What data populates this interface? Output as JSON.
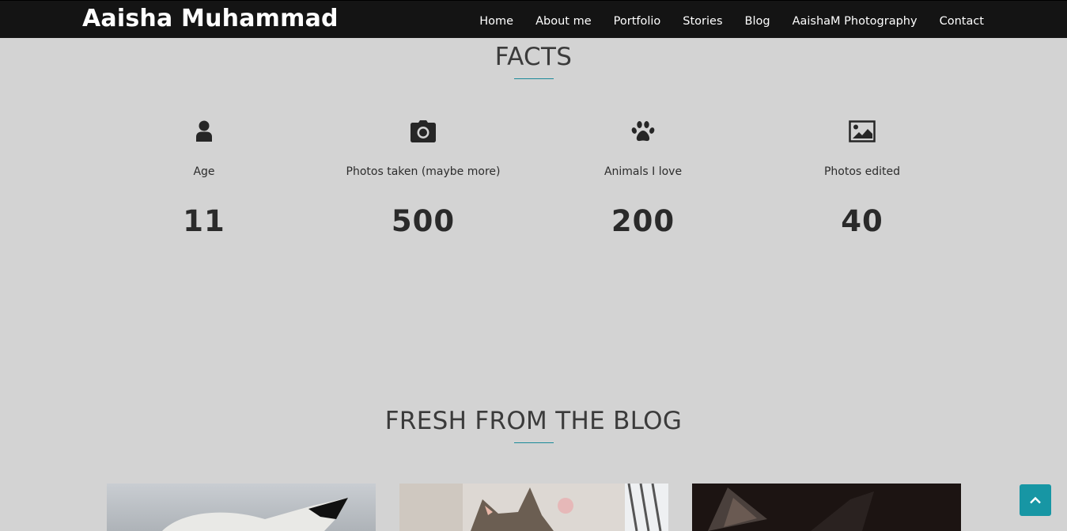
{
  "brand": "Aaisha Muhammad",
  "nav": {
    "items": [
      {
        "label": "Home"
      },
      {
        "label": "About me"
      },
      {
        "label": "Portfolio"
      },
      {
        "label": "Stories"
      },
      {
        "label": "Blog"
      },
      {
        "label": "AaishaM Photography"
      },
      {
        "label": "Contact"
      }
    ]
  },
  "facts": {
    "title": "FACTS",
    "items": [
      {
        "icon": "user-icon",
        "label": "Age",
        "value": "11"
      },
      {
        "icon": "camera-icon",
        "label": "Photos taken (maybe more)",
        "value": "500"
      },
      {
        "icon": "paw-icon",
        "label": "Animals I love",
        "value": "200"
      },
      {
        "icon": "image-icon",
        "label": "Photos edited",
        "value": "40"
      }
    ]
  },
  "blog": {
    "title": "FRESH FROM THE BLOG"
  },
  "colors": {
    "navbar": "#141414",
    "background": "#d3d3d3",
    "accent": "#1796a4"
  },
  "back_to_top_icon": "chevron-up-icon"
}
